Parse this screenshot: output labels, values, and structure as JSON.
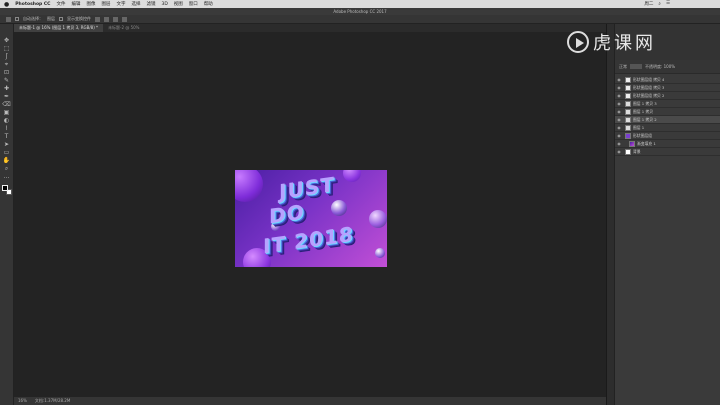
{
  "menubar": {
    "app_name": "Photoshop CC",
    "items": [
      "文件",
      "编辑",
      "图像",
      "图层",
      "文字",
      "选择",
      "滤镜",
      "3D",
      "视图",
      "窗口",
      "帮助"
    ],
    "right": [
      "周二",
      "⌕",
      "☰"
    ]
  },
  "window": {
    "title": "Adobe Photoshop CC 2017"
  },
  "options_bar": {
    "auto_select_label": "自动选择：",
    "target": "图层",
    "transform_label": "显示变换控件"
  },
  "document_tabs": [
    {
      "label": "未标题-1 @ 16% (图层 1 拷贝 3, RGB/8) *",
      "active": true
    },
    {
      "label": "未标题-2 @ 50%",
      "active": false
    }
  ],
  "tools": [
    "✥",
    "⬚",
    "ʃ",
    "⌖",
    "⊡",
    "✎",
    "✚",
    "✒",
    "⌫",
    "▣",
    "◐",
    "⌇",
    "T",
    "➤",
    "▭",
    "✋",
    "⌕",
    "…"
  ],
  "colors": {
    "foreground": "#000000",
    "background": "#ffffff",
    "accent": "#8a3fd1"
  },
  "artwork": {
    "line1": "JUST",
    "line2": "DO",
    "line3": "IT 2018"
  },
  "status_bar": {
    "zoom": "16%",
    "doc_info": "文档:1.37M/28.2M"
  },
  "watermark": {
    "text": "虎课网"
  },
  "layers_panel": {
    "blend_mode": "正常",
    "opacity": "不透明度: 100%",
    "layers": [
      {
        "name": "形状图层组 拷贝 4",
        "visible": true,
        "selected": false,
        "sub": false
      },
      {
        "name": "形状图层组 拷贝 3",
        "visible": true,
        "selected": false,
        "sub": false
      },
      {
        "name": "形状图层组 拷贝 2",
        "visible": true,
        "selected": false,
        "sub": false
      },
      {
        "name": "图层 1 拷贝 3",
        "visible": true,
        "selected": false,
        "sub": false
      },
      {
        "name": "图层 1 拷贝",
        "visible": true,
        "selected": false,
        "sub": false
      },
      {
        "name": "图层 1 拷贝 2",
        "visible": true,
        "selected": true,
        "sub": false
      },
      {
        "name": "图层 1",
        "visible": true,
        "selected": false,
        "sub": false
      },
      {
        "name": "形状图层组",
        "visible": true,
        "selected": false,
        "sub": false
      },
      {
        "name": "渐变填充 1",
        "visible": true,
        "selected": false,
        "sub": true
      },
      {
        "name": "背景",
        "visible": true,
        "selected": false,
        "sub": false
      }
    ]
  }
}
